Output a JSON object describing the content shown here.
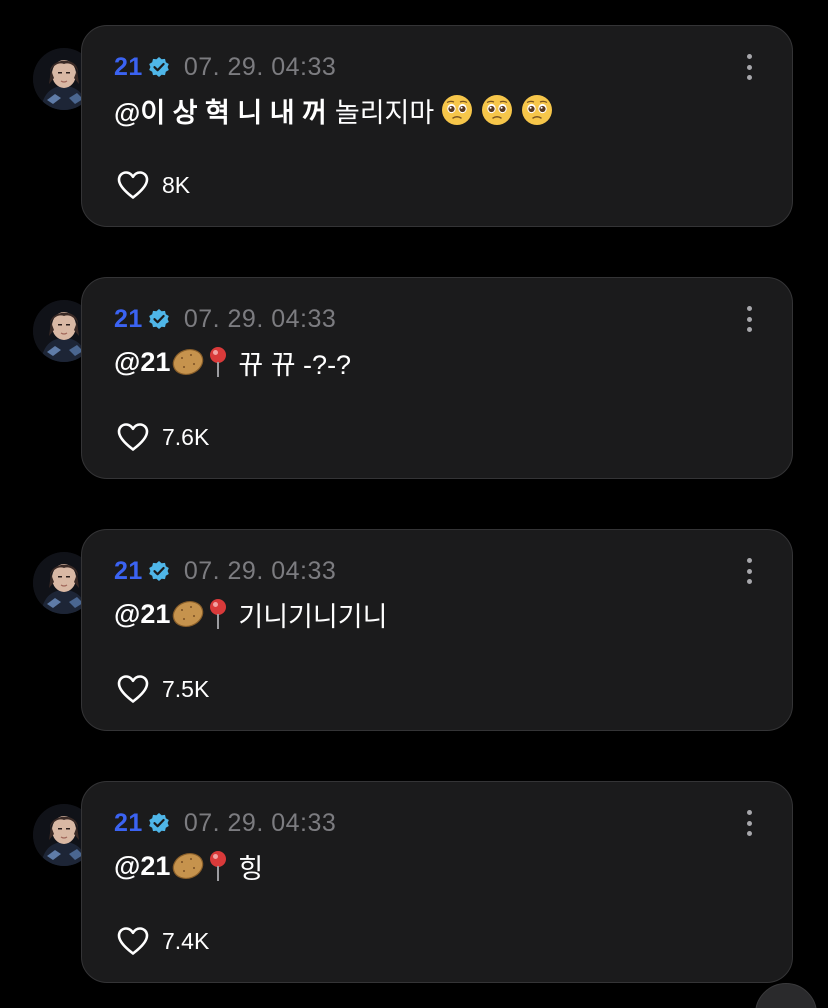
{
  "colors": {
    "background": "#000000",
    "card": "#1b1b1c",
    "username": "#3b63f2",
    "verified_badge": "#4fb6e8",
    "timestamp": "#7c7c80",
    "text": "#ffffff"
  },
  "posts": [
    {
      "username": "21",
      "timestamp": "07. 29. 04:33",
      "mention": "@이 상 혁 니 내 꺼",
      "message": "놀리지마",
      "emojis": [
        "pleading-face",
        "pleading-face",
        "pleading-face"
      ],
      "likes": "8K"
    },
    {
      "username": "21",
      "timestamp": "07. 29. 04:33",
      "mention": "@21",
      "mention_emojis": [
        "potato",
        "pushpin"
      ],
      "message": "뀨 뀨 -?-?",
      "likes": "7.6K"
    },
    {
      "username": "21",
      "timestamp": "07. 29. 04:33",
      "mention": "@21",
      "mention_emojis": [
        "potato",
        "pushpin"
      ],
      "message": "기니기니기니",
      "likes": "7.5K"
    },
    {
      "username": "21",
      "timestamp": "07. 29. 04:33",
      "mention": "@21",
      "mention_emojis": [
        "potato",
        "pushpin"
      ],
      "message": "힝",
      "likes": "7.4K"
    }
  ],
  "icons": {
    "avatar": "avatar-photo",
    "verified": "verified-badge-icon",
    "menu": "more-vertical-icon",
    "like": "heart-outline-icon"
  }
}
